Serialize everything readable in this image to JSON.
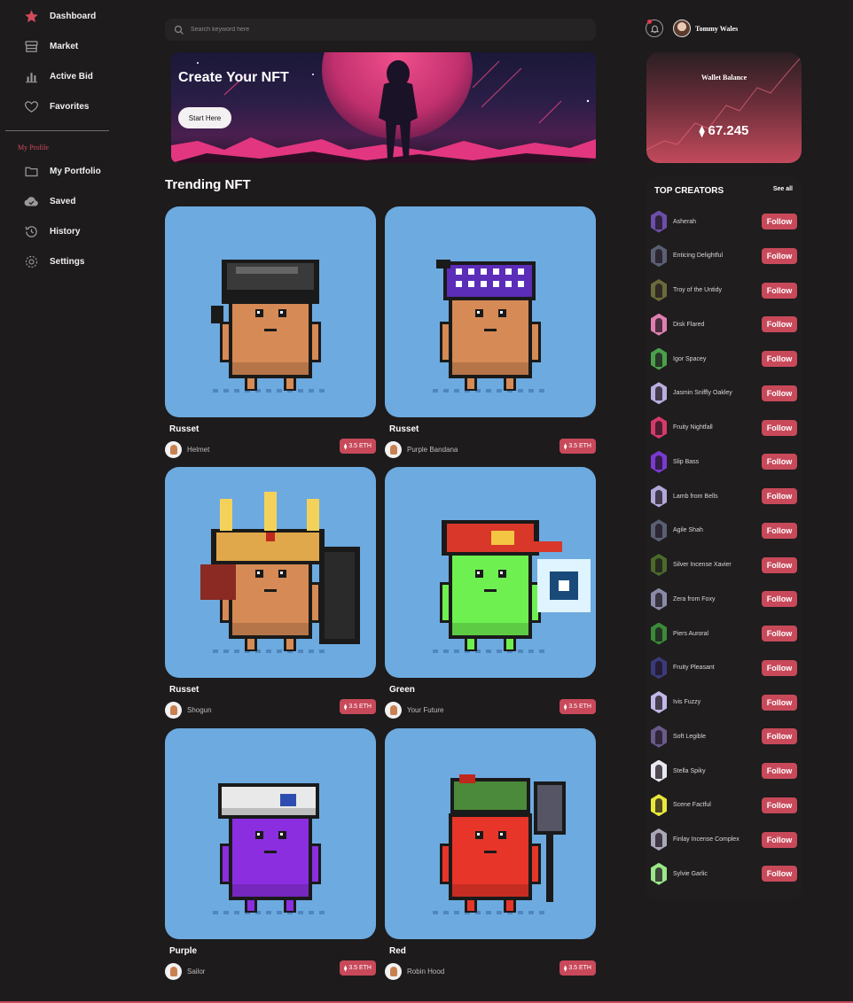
{
  "sidebar": {
    "items": [
      {
        "label": "Dashboard",
        "icon": "star-icon"
      },
      {
        "label": "Market",
        "icon": "store-icon"
      },
      {
        "label": "Active Bid",
        "icon": "bar-chart-icon"
      },
      {
        "label": "Favorites",
        "icon": "heart-icon"
      }
    ],
    "section_label": "My Profile",
    "profile_items": [
      {
        "label": "My Portfolio",
        "icon": "folder-icon"
      },
      {
        "label": "Saved",
        "icon": "cloud-check-icon"
      },
      {
        "label": "History",
        "icon": "history-icon"
      },
      {
        "label": "Settings",
        "icon": "settings-icon"
      }
    ]
  },
  "search": {
    "placeholder": "Search keyword here"
  },
  "banner": {
    "title": "Create Your NFT",
    "button": "Start Here"
  },
  "trending": {
    "title": "Trending NFT",
    "cards": [
      {
        "name": "Russet",
        "owner": "Helmet",
        "price": "3.5 ETH",
        "body_color": "#d68a55",
        "hat": "helmet"
      },
      {
        "name": "Russet",
        "owner": "Purple Bandana",
        "price": "3.5 ETH",
        "body_color": "#d68a55",
        "hat": "bandana"
      },
      {
        "name": "Russet",
        "owner": "Shogun",
        "price": "3.5 ETH",
        "body_color": "#d68a55",
        "hat": "shogun"
      },
      {
        "name": "Green",
        "owner": "Your Future",
        "price": "3.5 ETH",
        "body_color": "#6ef050",
        "hat": "cap"
      },
      {
        "name": "Purple",
        "owner": "Sailor",
        "price": "3.5 ETH",
        "body_color": "#8a2ee0",
        "hat": "sailor"
      },
      {
        "name": "Red",
        "owner": "Robin Hood",
        "price": "3.5 ETH",
        "body_color": "#e8352a",
        "hat": "robin"
      }
    ]
  },
  "user": {
    "name": "Tommy Wales"
  },
  "wallet": {
    "title": "Wallet Balance",
    "amount": "67.245"
  },
  "creators": {
    "title": "TOP CREATORS",
    "see_all": "See all",
    "follow_label": "Follow",
    "list": [
      {
        "name": "Asherah",
        "color": "#6b4fa8"
      },
      {
        "name": "Enticing Delightful",
        "color": "#5a5f74"
      },
      {
        "name": "Troy of the Untidy",
        "color": "#6a6a3a"
      },
      {
        "name": "Disk Flared",
        "color": "#e07fb0"
      },
      {
        "name": "Igor Spacey",
        "color": "#4aa04a"
      },
      {
        "name": "Jasmin Sniffly Oakley",
        "color": "#b8aee0"
      },
      {
        "name": "Fruity Nightfall",
        "color": "#d63a6a"
      },
      {
        "name": "Slip Bass",
        "color": "#7a3ad0"
      },
      {
        "name": "Lamb from Bells",
        "color": "#b0a8d8"
      },
      {
        "name": "Agile Shah",
        "color": "#5a5f74"
      },
      {
        "name": "Silver Incense Xavier",
        "color": "#4a6a2a"
      },
      {
        "name": "Zera from Foxy",
        "color": "#8a8aa8"
      },
      {
        "name": "Piers Auroral",
        "color": "#3a8a3a"
      },
      {
        "name": "Fruity Pleasant",
        "color": "#3a3a7a"
      },
      {
        "name": "Ivis Fuzzy",
        "color": "#c0b8e8"
      },
      {
        "name": "Soft Legible",
        "color": "#6a5a8a"
      },
      {
        "name": "Stella Spiky",
        "color": "#e8e8f0"
      },
      {
        "name": "Scene Factful",
        "color": "#e8e83a"
      },
      {
        "name": "Finlay Incense Complex",
        "color": "#a8a8b8"
      },
      {
        "name": "Sylvie Garlic",
        "color": "#9ae88a"
      }
    ]
  }
}
